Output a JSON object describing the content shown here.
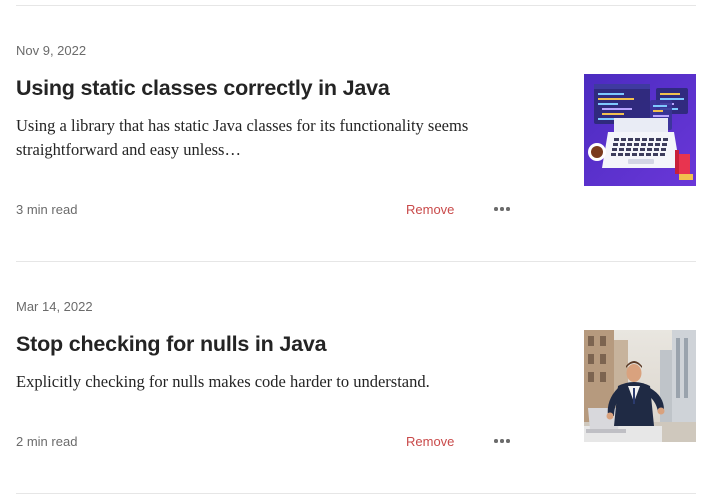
{
  "articles": [
    {
      "date": "Nov 9, 2022",
      "title": "Using static classes correctly in Java",
      "subtitle": "Using a library that has static Java classes for its functionality seems straightforward and easy unless…",
      "read_time": "3 min read",
      "remove_label": "Remove",
      "more_icon": "more-horizontal-icon",
      "thumbnail": "laptop-code-illustration"
    },
    {
      "date": "Mar 14, 2022",
      "title": "Stop checking for nulls in Java",
      "subtitle": "Explicitly checking for nulls makes code harder to understand.",
      "read_time": "2 min read",
      "remove_label": "Remove",
      "more_icon": "more-horizontal-icon",
      "thumbnail": "man-meditating-with-laptop-photo"
    }
  ],
  "colors": {
    "remove": "#c94a4a",
    "muted": "#6b6b6b",
    "divider": "#e6e6e6",
    "thumb_bg": "#5b2fc9"
  }
}
